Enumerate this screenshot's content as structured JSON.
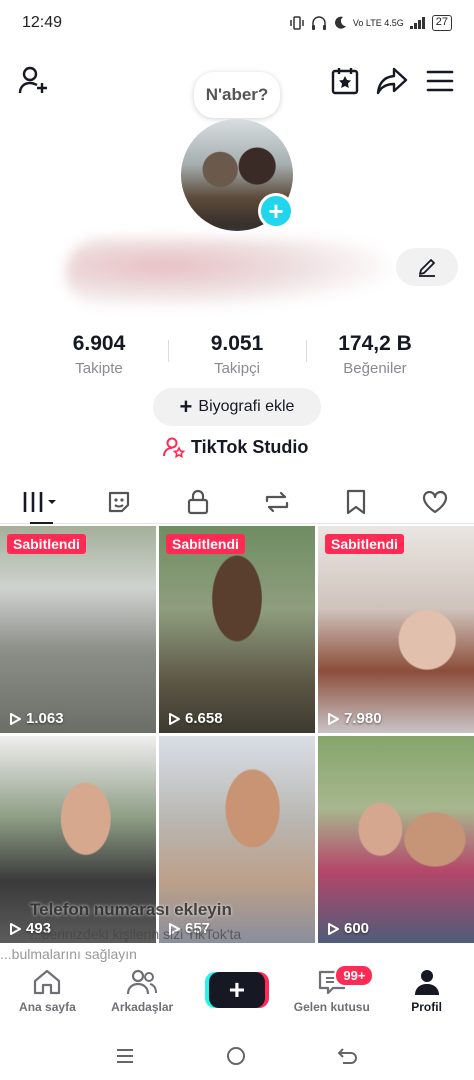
{
  "status_bar": {
    "time": "12:49",
    "network": "Vo LTE 4.5G",
    "battery": "27"
  },
  "header": {
    "add_friend_icon": "person-plus-icon",
    "calendar_icon": "calendar-star-icon",
    "share_icon": "share-arrow-icon",
    "menu_icon": "hamburger-menu-icon"
  },
  "profile": {
    "note_bubble": "N'aber?",
    "add_story_symbol": "+"
  },
  "stats": [
    {
      "value": "6.904",
      "label": "Takipte"
    },
    {
      "value": "9.051",
      "label": "Takipçi"
    },
    {
      "value": "174,2 B",
      "label": "Beğeniler"
    }
  ],
  "bio_button": {
    "icon": "+",
    "label": "Biyografi ekle"
  },
  "studio": {
    "label": "TikTok Studio"
  },
  "tabs": [
    "videos-grid-icon",
    "tagged-sticker-icon",
    "lock-icon",
    "repost-icon",
    "bookmark-icon",
    "heart-icon"
  ],
  "videos": [
    {
      "pinned": "Sabitlendi",
      "views": "1.063"
    },
    {
      "pinned": "Sabitlendi",
      "views": "6.658"
    },
    {
      "pinned": "Sabitlendi",
      "views": "7.980"
    },
    {
      "pinned": "",
      "views": "493"
    },
    {
      "pinned": "",
      "views": "657"
    },
    {
      "pinned": "",
      "views": "600"
    }
  ],
  "overlay": {
    "title": "Telefon numarası ekleyin",
    "line1": "...berinizdeki kişilerin sizi TikTok'ta",
    "line2": "...bulmalarını sağlayın"
  },
  "bottom_nav": [
    {
      "label": "Ana sayfa",
      "icon": "home-icon"
    },
    {
      "label": "Arkadaşlar",
      "icon": "friends-icon"
    },
    {
      "label": "",
      "icon": "plus-icon"
    },
    {
      "label": "Gelen kutusu",
      "icon": "inbox-icon",
      "badge": "99+"
    },
    {
      "label": "Profil",
      "icon": "profile-icon"
    }
  ],
  "colors": {
    "accent": "#fe2c55",
    "cyan": "#25f4ee",
    "plus_blue": "#20d5ec"
  }
}
